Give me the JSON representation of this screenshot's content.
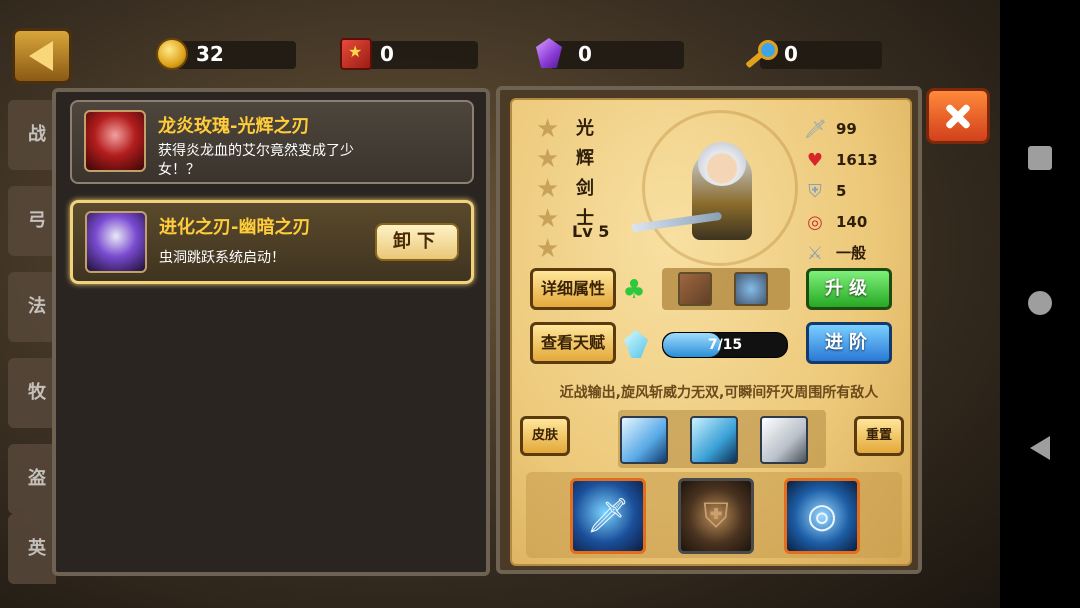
{
  "resources": {
    "coins": "32",
    "tickets": "0",
    "gems": "0",
    "keys": "0"
  },
  "side_tabs": [
    "战",
    "弓",
    "法",
    "牧",
    "盗",
    "英"
  ],
  "skins": [
    {
      "title": "龙炎玫瑰-光辉之刃",
      "desc": "获得炎龙血的艾尔竟然变成了少女！？"
    },
    {
      "title": "进化之刃-幽暗之刃",
      "desc": "虫洞跳跃系统启动！",
      "button": "卸下"
    }
  ],
  "hero": {
    "name_chars": [
      "光",
      "辉",
      "剑",
      "士"
    ],
    "level": "Lv 5",
    "stars": 5,
    "stats": {
      "attack": "99",
      "hp": "1613",
      "defense": "5",
      "accuracy": "140",
      "weapon": "一般"
    },
    "buttons": {
      "details": "详细属性",
      "talent": "查看天赋",
      "upgrade": "升级",
      "advance": "进阶",
      "skin": "皮肤",
      "reset": "重置"
    },
    "talent_progress": {
      "text": "7/15",
      "value": 7,
      "max": 15
    },
    "description": "近战输出,旋风斩威力无双,可瞬间歼灭周围所有敌人"
  },
  "icons": {
    "coin": "coin-icon",
    "ticket": "red-book-icon",
    "gem": "purple-gem-icon",
    "key": "key-icon",
    "close": "close-icon",
    "back": "back-arrow-icon"
  },
  "colors": {
    "accent_gold": "#ffcc3a",
    "green_button": "#27a824",
    "blue_button": "#2a78d6",
    "close_button": "#d2401c"
  }
}
